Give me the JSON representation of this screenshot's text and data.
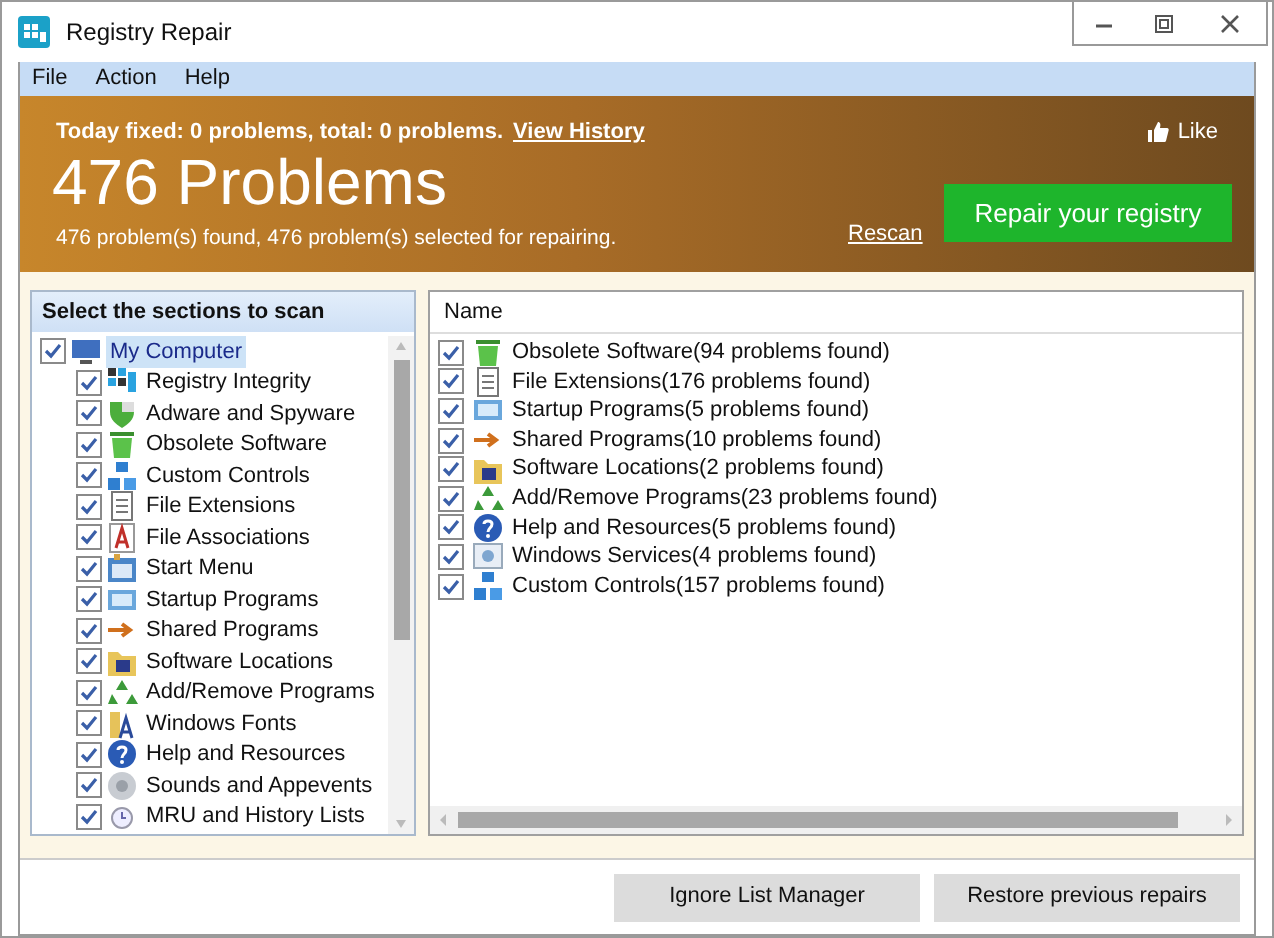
{
  "window": {
    "title": "Registry Repair"
  },
  "menu": [
    {
      "label": "File"
    },
    {
      "label": "Action"
    },
    {
      "label": "Help"
    }
  ],
  "header": {
    "summary": "Today fixed: 0 problems, total: 0 problems.",
    "history_link": "View History",
    "like": "Like",
    "title": "476 Problems",
    "subtitle": "476 problem(s) found, 476 problem(s) selected for repairing.",
    "rescan": "Rescan",
    "repair_button": "Repair your registry"
  },
  "sections": {
    "heading": "Select the sections to scan",
    "tree": [
      {
        "label": "My Computer",
        "checked": true,
        "selected": true,
        "children": [
          {
            "label": "Registry Integrity",
            "checked": true,
            "selected": false
          },
          {
            "label": "Adware and Spyware",
            "checked": true,
            "selected": false
          },
          {
            "label": "Obsolete Software",
            "checked": true,
            "selected": false
          },
          {
            "label": "Custom Controls",
            "checked": true,
            "selected": false
          },
          {
            "label": "File Extensions",
            "checked": true,
            "selected": false
          },
          {
            "label": "File Associations",
            "checked": true,
            "selected": false
          },
          {
            "label": "Start Menu",
            "checked": true,
            "selected": false
          },
          {
            "label": "Startup Programs",
            "checked": true,
            "selected": false
          },
          {
            "label": "Shared Programs",
            "checked": true,
            "selected": false
          },
          {
            "label": "Software Locations",
            "checked": true,
            "selected": false
          },
          {
            "label": "Add/Remove Programs",
            "checked": true,
            "selected": false
          },
          {
            "label": "Windows Fonts",
            "checked": true,
            "selected": false
          },
          {
            "label": "Help and Resources",
            "checked": true,
            "selected": false
          },
          {
            "label": "Sounds and Appevents",
            "checked": true,
            "selected": false
          },
          {
            "label": "MRU and History Lists",
            "checked": true,
            "selected": false
          }
        ]
      }
    ]
  },
  "results": {
    "columns": [
      "Name"
    ],
    "rows": [
      {
        "label": "Obsolete Software(94 problems found)",
        "checked": true
      },
      {
        "label": "File Extensions(176 problems found)",
        "checked": true
      },
      {
        "label": "Startup Programs(5 problems found)",
        "checked": true
      },
      {
        "label": "Shared Programs(10 problems found)",
        "checked": true
      },
      {
        "label": "Software Locations(2 problems found)",
        "checked": true
      },
      {
        "label": "Add/Remove Programs(23 problems found)",
        "checked": true
      },
      {
        "label": "Help and Resources(5 problems found)",
        "checked": true
      },
      {
        "label": "Windows Services(4 problems found)",
        "checked": true
      },
      {
        "label": "Custom Controls(157 problems found)",
        "checked": true
      }
    ]
  },
  "buttons": [
    {
      "label": "Ignore List Manager"
    },
    {
      "label": "Restore previous repairs"
    }
  ]
}
